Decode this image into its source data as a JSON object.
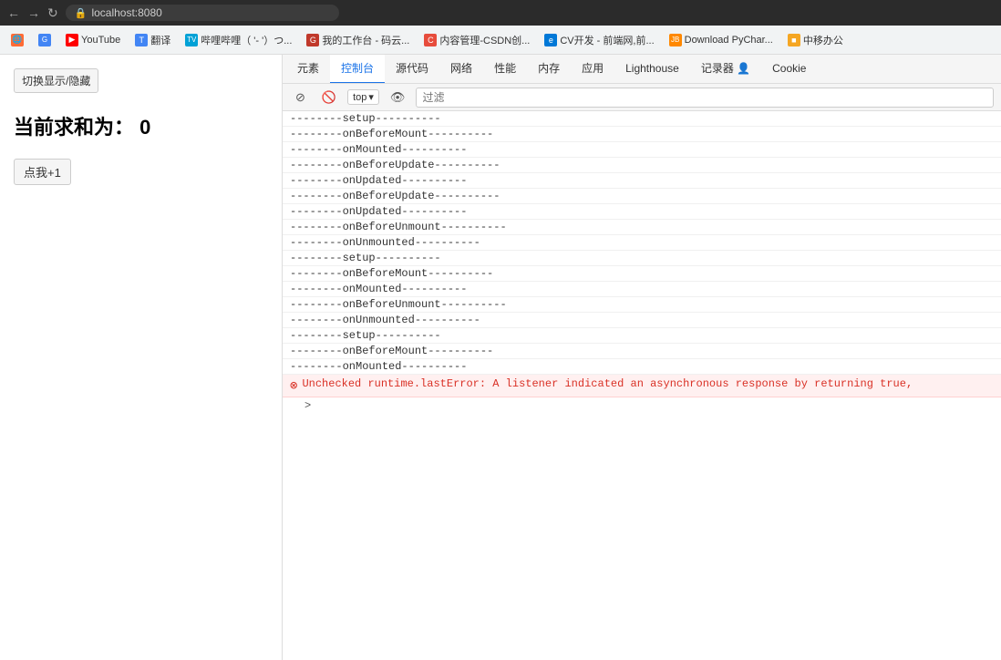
{
  "browser": {
    "address": "localhost:8080",
    "nav": {
      "back": "←",
      "forward": "→",
      "reload": "↻"
    }
  },
  "bookmarks": [
    {
      "id": "b1",
      "label": "",
      "icon": "🌐",
      "color": "#ff6b35"
    },
    {
      "id": "b2",
      "label": "",
      "icon": "G",
      "color": "#4285f4"
    },
    {
      "id": "b3",
      "label": "YouTube",
      "icon": "▶",
      "color": "#ff0000"
    },
    {
      "id": "b4",
      "label": "翻译",
      "icon": "T",
      "color": "#4285f4"
    },
    {
      "id": "b5",
      "label": "哔哩哔哩（ '- '）つ...",
      "icon": "TV",
      "color": "#00a1d6"
    },
    {
      "id": "b6",
      "label": "我的工作台 - 码云...",
      "icon": "G",
      "color": "#c0392b"
    },
    {
      "id": "b7",
      "label": "内容管理-CSDN创...",
      "icon": "C",
      "color": "#e74c3c"
    },
    {
      "id": "b8",
      "label": "CV开发 - 前端网,前...",
      "icon": "e",
      "color": "#0078d7"
    },
    {
      "id": "b9",
      "label": "Download PyChar...",
      "icon": "JB",
      "color": "#ff8800"
    },
    {
      "id": "b10",
      "label": "中移办公",
      "icon": "■",
      "color": "#f5a623"
    }
  ],
  "webpage": {
    "toggle_btn": "切换显示/隐藏",
    "title": "当前求和为： 0",
    "click_btn": "点我+1"
  },
  "devtools": {
    "tabs": [
      {
        "id": "elements",
        "label": "元素",
        "active": false
      },
      {
        "id": "console",
        "label": "控制台",
        "active": true
      },
      {
        "id": "sources",
        "label": "源代码",
        "active": false
      },
      {
        "id": "network",
        "label": "网络",
        "active": false
      },
      {
        "id": "performance",
        "label": "性能",
        "active": false
      },
      {
        "id": "memory",
        "label": "内存",
        "active": false
      },
      {
        "id": "application",
        "label": "应用",
        "active": false
      },
      {
        "id": "lighthouse",
        "label": "Lighthouse",
        "active": false
      },
      {
        "id": "recorder",
        "label": "记录器 👤",
        "active": false
      },
      {
        "id": "cookie",
        "label": "Cookie",
        "active": false
      }
    ],
    "toolbar": {
      "top_label": "top",
      "filter_placeholder": "过滤"
    },
    "console_lines": [
      "--------setup----------",
      "--------onBeforeMount----------",
      "--------onMounted----------",
      "--------onBeforeUpdate----------",
      "--------onUpdated----------",
      "--------onBeforeUpdate----------",
      "--------onUpdated----------",
      "--------onBeforeUnmount----------",
      "--------onUnmounted----------",
      "--------setup----------",
      "--------onBeforeMount----------",
      "--------onMounted----------",
      "--------onBeforeUnmount----------",
      "--------onUnmounted----------",
      "--------setup----------",
      "--------onBeforeMount----------",
      "--------onMounted----------"
    ],
    "error": {
      "icon": "⊗",
      "message": "Unchecked runtime.lastError: A listener indicated an asynchronous response by returning true,"
    },
    "expand_arrow": ">"
  }
}
